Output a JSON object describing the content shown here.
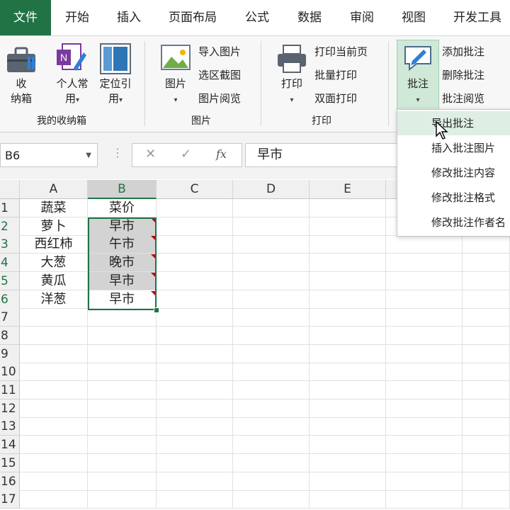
{
  "tabs": [
    {
      "label": "文件",
      "active": true
    },
    {
      "label": "开始"
    },
    {
      "label": "插入"
    },
    {
      "label": "页面布局"
    },
    {
      "label": "公式"
    },
    {
      "label": "数据"
    },
    {
      "label": "审阅"
    },
    {
      "label": "视图"
    },
    {
      "label": "开发工具"
    }
  ],
  "ribbon": {
    "storage_group": {
      "label": "我的收纳箱",
      "storage_line1": "收",
      "storage_line2": "纳箱",
      "personal_line1": "个人常",
      "personal_line2": "用",
      "locate_line1": "定位引",
      "locate_line2": "用"
    },
    "picture_group": {
      "label": "图片",
      "picture_button": "图片",
      "import": "导入图片",
      "crop": "选区截图",
      "browse": "图片阅览"
    },
    "print_group": {
      "label": "打印",
      "print_button": "打印",
      "print_current": "打印当前页",
      "batch": "批量打印",
      "duplex": "双面打印"
    },
    "comment_group": {
      "comment_button": "批注",
      "add": "添加批注",
      "delete": "删除批注",
      "browse": "批注阅览"
    },
    "caret": "▾"
  },
  "comment_menu": {
    "items": [
      "导出批注",
      "插入批注图片",
      "修改批注内容",
      "修改批注格式",
      "修改批注作者名"
    ],
    "hovered": "导出批注"
  },
  "formula_bar": {
    "name_box": "B6",
    "cancel": "✕",
    "confirm": "✓",
    "fx": "fx",
    "value": "早市"
  },
  "sheet": {
    "columns": [
      "A",
      "B",
      "C",
      "D",
      "E"
    ],
    "selected_column": "B",
    "rows": [
      "1",
      "2",
      "3",
      "4",
      "5",
      "6",
      "7",
      "8",
      "9",
      "10",
      "11",
      "12",
      "13",
      "14",
      "15",
      "16",
      "17"
    ],
    "cells": {
      "A1": "蔬菜",
      "B1": "菜价",
      "A2": "萝卜",
      "B2": "早市",
      "A3": "西红柿",
      "B3": "午市",
      "A4": "大葱",
      "B4": "晚市",
      "A5": "黄瓜",
      "B5": "早市",
      "A6": "洋葱",
      "B6": "早市"
    }
  },
  "colors": {
    "accent": "#217346",
    "comment_marker": "#c00000",
    "selection_fill": "#d3d3d3"
  }
}
